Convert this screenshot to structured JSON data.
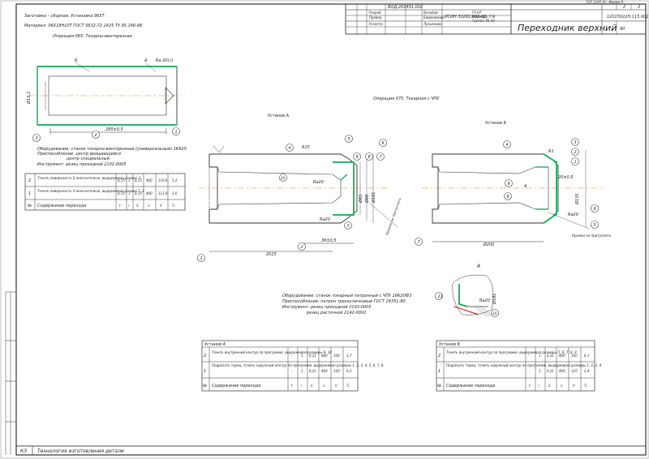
{
  "title_block": {
    "doc_code": "ТОТ 2105 Кс. Форма 8",
    "sheet": "2",
    "sheets": "2",
    "drawing_no": "ВОД.201451.002",
    "part_code": "ИСИН 30261/001-02",
    "part_name": "Переходник верхний",
    "op_code": "12015022Н.115.001",
    "quantity": "90",
    "roles": [
      "Разраб.",
      "Провер.",
      "Н.контр."
    ],
    "names": [
      "Вальбой",
      "Евдокимова",
      "Лукьянова"
    ],
    "org": [
      "ГУ НТ",
      "Кафедра ТГМ",
      "Группа ТБ-10"
    ]
  },
  "header": {
    "blank": "Заготовка – сборная. Установка 965Т",
    "material": "Материал: 06Х18Н10Т ГОСТ 5632-72  2425 ТУ 95.166-98"
  },
  "op065": {
    "title": "Операция 065. Токарно-винторезная",
    "roughness": "Ra 20(√)",
    "dims": [
      "Ø15,2",
      "285±0,5"
    ],
    "letters": [
      "Б",
      "А"
    ],
    "equipment": [
      "Оборудование: станок токарно-винторезный (универсальный) 1К625",
      "Приспособление: центр вращающийся",
      "центр специальный",
      "Инструмент: резец проходной 2102-0005"
    ],
    "table": [
      {
        "n": "2",
        "text": "Точить поверхность Б окончательно, выдерживая размер 3",
        "vals": [
          "0,15",
          "1",
          "0,15",
          "400",
          "119,6",
          "5,2"
        ]
      },
      {
        "n": "1",
        "text": "Точить поверхность А окончательно, выдерживая размер 1, 2",
        "vals": [
          "0,15",
          "1",
          "0,15",
          "400",
          "111,8",
          "3,0"
        ]
      },
      {
        "n": "№",
        "text": "Содержание перехода",
        "vals": [
          "t",
          "i",
          "S",
          "n",
          "V",
          "Tₒ"
        ]
      }
    ]
  },
  "op075": {
    "title": "Операция 075. Токарная с ЧПУ",
    "setupA": "Установ А",
    "setupB": "Установ Б",
    "viewA": "А",
    "equipment": [
      "Оборудование: станок токарный патронный с ЧПУ 16К20Ф3",
      "Приспособление: патрон трехкулачковый ГОСТ 24351-80",
      "Инструмент: резец проходной 2103-0005",
      "резец расточной 2142-0002"
    ],
    "dimsA": [
      "2015",
      "36±0,5",
      "Ø85",
      "Ø88",
      "Ø181",
      "Ra20",
      "R15"
    ],
    "dimsB": [
      "Ø200",
      "20±0,5",
      "Ø135",
      "Ra20",
      "R1"
    ],
    "note": "Кромки не притуплять"
  },
  "tableA": {
    "caption": "Установ А",
    "rows": [
      {
        "n": "2",
        "text": "Точить внутренний контур по программе, выдерживая размеры 9, 10",
        "vals": [
          "–",
          "1",
          "0,21",
          "400",
          "100",
          "3,7"
        ]
      },
      {
        "n": "1",
        "text": "Подрезать торец, точить наружный контур по программе, выдерживая размеры 1, 2, 3, 4, 5, 6, 7, 8",
        "vals": [
          "–",
          "1",
          "0,21",
          "400",
          "120",
          "6,2"
        ]
      },
      {
        "n": "№",
        "text": "Содержание перехода",
        "vals": [
          "t",
          "i",
          "S",
          "n",
          "V",
          "Tₒ"
        ]
      }
    ]
  },
  "tableB": {
    "caption": "Установ Б",
    "rows": [
      {
        "n": "2",
        "text": "Точить внутренний контур по программе, выдерживая размеры 5, 6, 7, 8, 9",
        "vals": [
          "–",
          "1",
          "0,21",
          "400",
          "100",
          "6,1"
        ]
      },
      {
        "n": "1",
        "text": "Подрезать торец, точить наружный контур по программе, выдерживая размеры 1, 2, 3, 4",
        "vals": [
          "–",
          "1",
          "0,21",
          "400",
          "125",
          "2,4"
        ]
      },
      {
        "n": "№",
        "text": "Содержание перехода",
        "vals": [
          "t",
          "i",
          "S",
          "n",
          "V",
          "Tₒ"
        ]
      }
    ]
  },
  "footer": {
    "code": "КЗ",
    "text": "Технология изготовления детали"
  }
}
